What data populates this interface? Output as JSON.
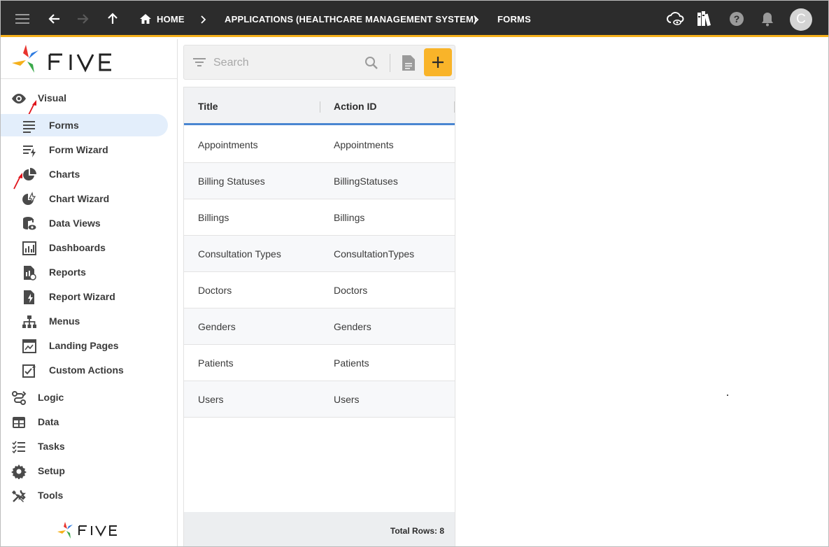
{
  "topbar": {
    "breadcrumbs": [
      {
        "label": "HOME"
      },
      {
        "label": "APPLICATIONS (HEALTHCARE MANAGEMENT SYSTEM)"
      },
      {
        "label": "FORMS"
      }
    ],
    "avatar_initial": "C",
    "accent_color": "#f5b01b",
    "icons": [
      "menu-icon",
      "back-arrow-icon",
      "forward-arrow-icon",
      "up-arrow-icon",
      "home-icon",
      "cloud-eye-icon",
      "books-icon",
      "help-icon",
      "bell-icon"
    ]
  },
  "sidebar": {
    "logo_text": "FIVE",
    "sections": {
      "visual": "Visual",
      "logic": "Logic",
      "data": "Data",
      "tasks": "Tasks",
      "setup": "Setup",
      "tools": "Tools"
    },
    "visual_items": [
      {
        "label": "Forms",
        "icon": "list-lines-icon",
        "active": true
      },
      {
        "label": "Form Wizard",
        "icon": "form-wizard-icon"
      },
      {
        "label": "Charts",
        "icon": "pie-chart-icon"
      },
      {
        "label": "Chart Wizard",
        "icon": "chart-wizard-icon"
      },
      {
        "label": "Data Views",
        "icon": "database-eye-icon"
      },
      {
        "label": "Dashboards",
        "icon": "dashboard-icon"
      },
      {
        "label": "Reports",
        "icon": "report-icon"
      },
      {
        "label": "Report Wizard",
        "icon": "report-wizard-icon"
      },
      {
        "label": "Menus",
        "icon": "sitemap-icon"
      },
      {
        "label": "Landing Pages",
        "icon": "landing-page-icon"
      },
      {
        "label": "Custom Actions",
        "icon": "custom-action-icon"
      }
    ],
    "bottom_logo_text": "FIVE"
  },
  "list": {
    "search_placeholder": "Search",
    "columns": [
      "Title",
      "Action ID"
    ],
    "rows": [
      [
        "Appointments",
        "Appointments"
      ],
      [
        "Billing Statuses",
        "BillingStatuses"
      ],
      [
        "Billings",
        "Billings"
      ],
      [
        "Consultation Types",
        "ConsultationTypes"
      ],
      [
        "Doctors",
        "Doctors"
      ],
      [
        "Genders",
        "Genders"
      ],
      [
        "Patients",
        "Patients"
      ],
      [
        "Users",
        "Users"
      ]
    ],
    "footer": "Total Rows: 8"
  }
}
